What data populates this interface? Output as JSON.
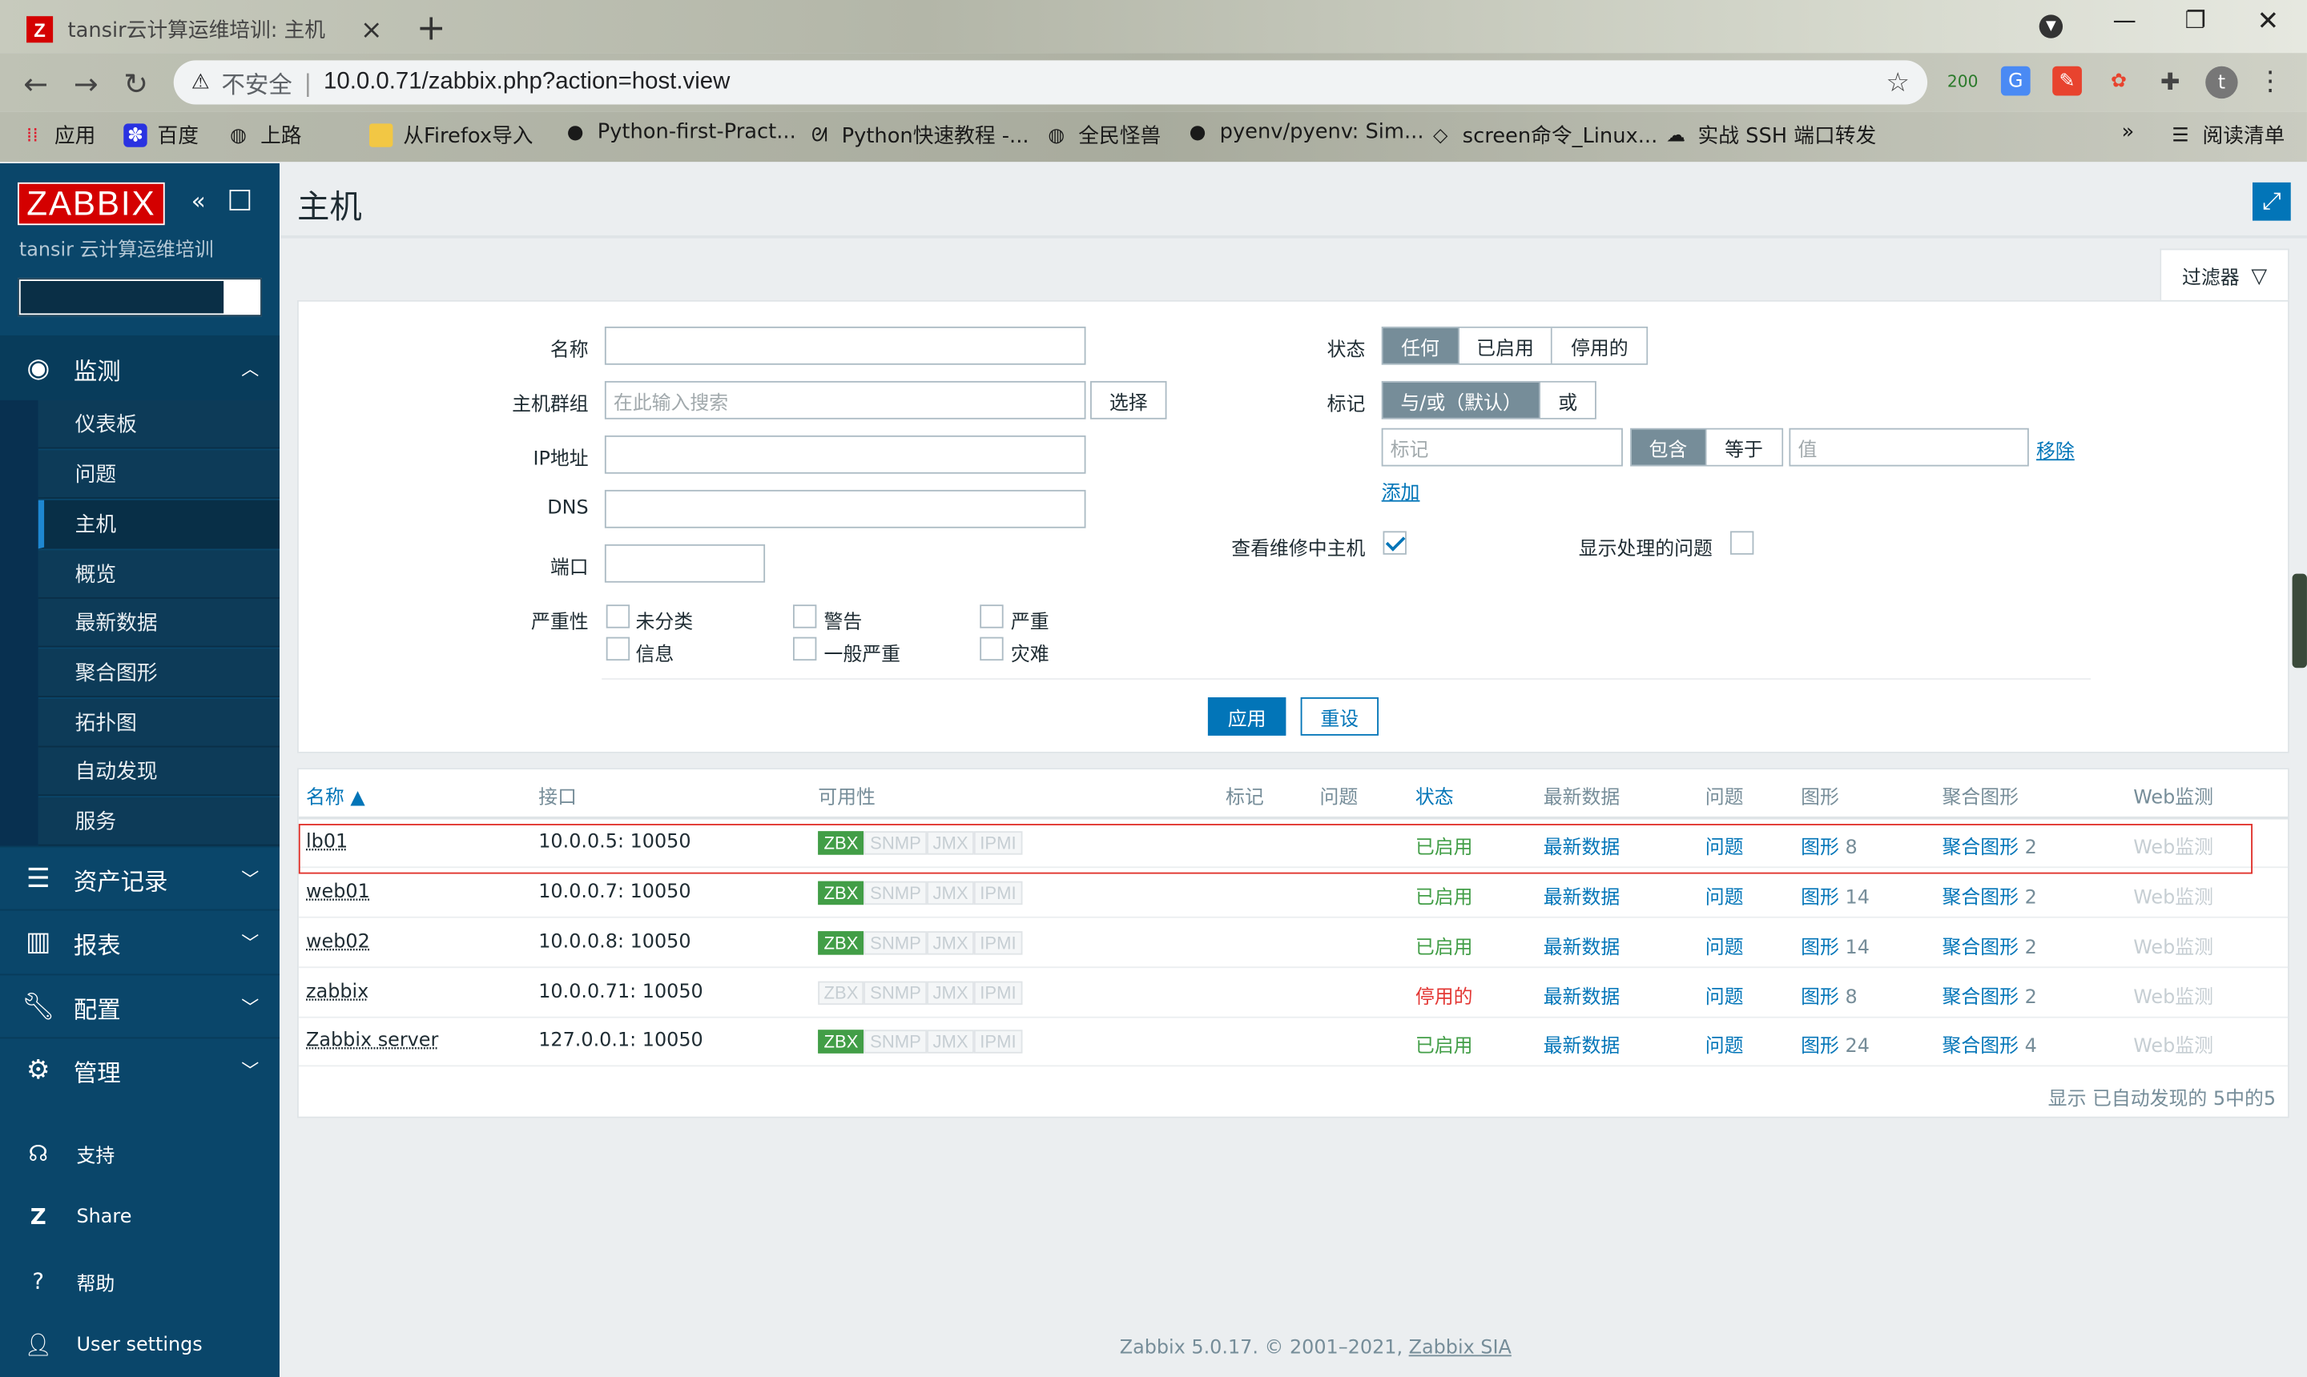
{
  "browser": {
    "tab_title": "tansir云计算运维培训: 主机",
    "tab_favicon": "Z",
    "security": "不安全",
    "url": "10.0.0.71/zabbix.php?action=host.view",
    "ext_badge": "200",
    "avatar_letter": "t",
    "bookmarks": [
      {
        "label": "应用",
        "icon": "apps-grid-icon"
      },
      {
        "label": "百度",
        "icon": "baidu-paw-icon"
      },
      {
        "label": "上路",
        "icon": "globe-icon"
      },
      {
        "label": "从Firefox导入",
        "icon": "folder-icon"
      },
      {
        "label": "Python-first-Pract...",
        "icon": "github-icon"
      },
      {
        "label": "Python快速教程 -...",
        "icon": "feather-icon"
      },
      {
        "label": "全民怪兽",
        "icon": "globe-icon"
      },
      {
        "label": "pyenv/pyenv: Sim...",
        "icon": "github-icon"
      },
      {
        "label": "screen命令_Linux...",
        "icon": "diamond-icon"
      },
      {
        "label": "实战 SSH 端口转发",
        "icon": "cloud-icon"
      }
    ],
    "bookmarks_overflow": "»",
    "reading_list": "阅读清单"
  },
  "sidebar": {
    "logo": "ZABBIX",
    "subtitle": "tansir 云计算运维培训",
    "sections": [
      {
        "label": "监测",
        "icon": "eye-icon"
      },
      {
        "label": "资产记录",
        "icon": "list-icon"
      },
      {
        "label": "报表",
        "icon": "bar-chart-icon"
      },
      {
        "label": "配置",
        "icon": "wrench-icon"
      },
      {
        "label": "管理",
        "icon": "gear-icon"
      }
    ],
    "monitoring_items": [
      "仪表板",
      "问题",
      "主机",
      "概览",
      "最新数据",
      "聚合图形",
      "拓扑图",
      "自动发现",
      "服务"
    ],
    "footer": [
      {
        "label": "支持",
        "icon": "headset-icon"
      },
      {
        "label": "Share",
        "icon": "zabbix-share-icon"
      },
      {
        "label": "帮助",
        "icon": "question-icon"
      },
      {
        "label": "User settings",
        "icon": "user-icon"
      }
    ]
  },
  "page": {
    "title": "主机",
    "filter_tab": "过滤器"
  },
  "filter": {
    "name_label": "名称",
    "group_label": "主机群组",
    "group_placeholder": "在此输入搜索",
    "select_btn": "选择",
    "ip_label": "IP地址",
    "dns_label": "DNS",
    "port_label": "端口",
    "severity_label": "严重性",
    "severities": [
      "未分类",
      "警告",
      "严重",
      "信息",
      "一般严重",
      "灾难"
    ],
    "status_label": "状态",
    "status_options": [
      "任何",
      "已启用",
      "停用的"
    ],
    "tags_label": "标记",
    "tag_mode_options": [
      "与/或（默认）",
      "或"
    ],
    "tag_placeholder": "标记",
    "tag_op_options": [
      "包含",
      "等于"
    ],
    "value_placeholder": "值",
    "remove_link": "移除",
    "add_link": "添加",
    "maint_label": "查看维修中主机",
    "suppressed_label": "显示处理的问题",
    "apply": "应用",
    "reset": "重设"
  },
  "table": {
    "headers": [
      "名称 ▲",
      "接口",
      "可用性",
      "标记",
      "问题",
      "状态",
      "最新数据",
      "问题",
      "图形",
      "聚合图形",
      "Web监测"
    ],
    "avail_labels": [
      "ZBX",
      "SNMP",
      "JMX",
      "IPMI"
    ],
    "rows": [
      {
        "name": "lb01",
        "iface": "10.0.0.5: 10050",
        "zbx": true,
        "status": "已启用",
        "latest": "最新数据",
        "problems": "问题",
        "graphs": "图形",
        "graphs_n": "8",
        "screens": "聚合图形",
        "screens_n": "2",
        "web": "Web监测"
      },
      {
        "name": "web01",
        "iface": "10.0.0.7: 10050",
        "zbx": true,
        "status": "已启用",
        "latest": "最新数据",
        "problems": "问题",
        "graphs": "图形",
        "graphs_n": "14",
        "screens": "聚合图形",
        "screens_n": "2",
        "web": "Web监测"
      },
      {
        "name": "web02",
        "iface": "10.0.0.8: 10050",
        "zbx": true,
        "status": "已启用",
        "latest": "最新数据",
        "problems": "问题",
        "graphs": "图形",
        "graphs_n": "14",
        "screens": "聚合图形",
        "screens_n": "2",
        "web": "Web监测"
      },
      {
        "name": "zabbix",
        "iface": "10.0.0.71: 10050",
        "zbx": false,
        "status": "停用的",
        "latest": "最新数据",
        "problems": "问题",
        "graphs": "图形",
        "graphs_n": "8",
        "screens": "聚合图形",
        "screens_n": "2",
        "web": "Web监测"
      },
      {
        "name": "Zabbix server",
        "iface": "127.0.0.1: 10050",
        "zbx": true,
        "status": "已启用",
        "latest": "最新数据",
        "problems": "问题",
        "graphs": "图形",
        "graphs_n": "24",
        "screens": "聚合图形",
        "screens_n": "4",
        "web": "Web监测"
      }
    ],
    "footer": "显示 已自动发现的 5中的5"
  },
  "copyright_prefix": "Zabbix 5.0.17. © 2001–2021, ",
  "copyright_link": "Zabbix SIA",
  "colors": {
    "sidebar": "#0a466a",
    "accent": "#0275b8",
    "enabled": "#429e47",
    "disabled": "#e33734",
    "highlight": "#e0302a"
  }
}
